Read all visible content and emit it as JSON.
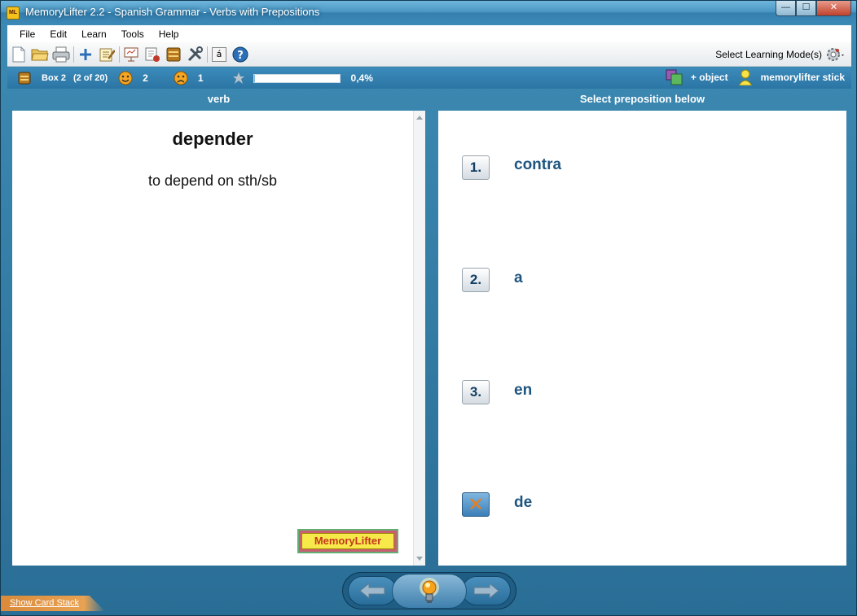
{
  "window": {
    "title": "MemoryLifter 2.2 - Spanish Grammar - Verbs with Prepositions",
    "app_icon_text": "ML",
    "controls": {
      "minimize": "—",
      "maximize": "☐",
      "close": "✕"
    }
  },
  "menu": {
    "items": [
      "File",
      "Edit",
      "Learn",
      "Tools",
      "Help"
    ]
  },
  "toolbar": {
    "icons": [
      "new-file-icon",
      "open-folder-icon",
      "print-icon",
      "add-card-icon",
      "edit-card-icon",
      "presentation-icon",
      "cards-icon",
      "box-icon",
      "tools-icon",
      "special-char-icon",
      "help-icon"
    ],
    "special_char_label": "á",
    "learning_mode_label": "Select Learning Mode(s)"
  },
  "status": {
    "box_label": "Box 2",
    "box_position": "(2 of 20)",
    "correct_count": "2",
    "wrong_count": "1",
    "progress_text": "0,4%",
    "progress_fraction": 0.004,
    "object_label": "+ object",
    "user_label": "memorylifter stick"
  },
  "columns": {
    "left_header": "verb",
    "right_header": "Select preposition below"
  },
  "question": {
    "word": "depender",
    "translation": "to depend on sth/sb"
  },
  "logo": {
    "text": "MemoryLifter"
  },
  "answers": [
    {
      "number": "1.",
      "text": "contra",
      "state": "normal"
    },
    {
      "number": "2.",
      "text": "a",
      "state": "normal"
    },
    {
      "number": "3.",
      "text": "en",
      "state": "normal"
    },
    {
      "number": "✕",
      "text": "de",
      "state": "wrong"
    }
  ],
  "bottom": {
    "card_stack_link": "Show Card Stack"
  },
  "colors": {
    "frame": "#2a6e96",
    "accent_text": "#1e5580",
    "wrong_mark": "#e67e22"
  }
}
